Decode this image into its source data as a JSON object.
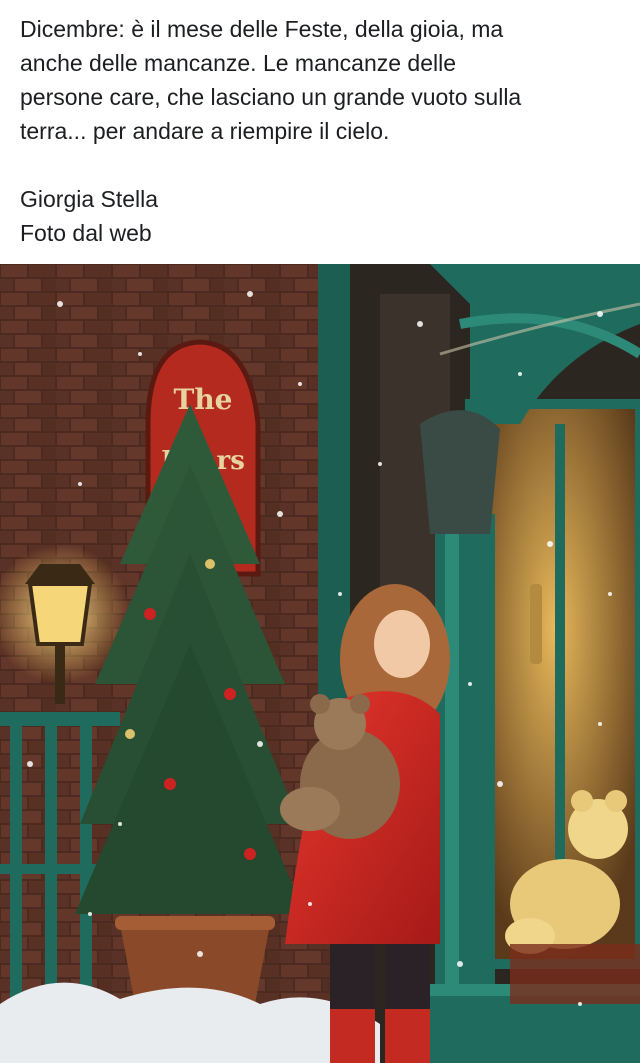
{
  "post": {
    "body_lines": [
      "Dicembre: è il mese delle Feste, della gioia, ma",
      "anche delle mancanze. Le mancanze delle",
      "persone care, che lasciano un grande vuoto sulla",
      "terra... per andare a riempire il cielo."
    ],
    "author": "Giorgia Stella",
    "credit": "Foto dal web"
  },
  "photo": {
    "sign_line_1": "The",
    "sign_line_2": "Bears"
  },
  "colors": {
    "text": "#1c1e21",
    "coat_red": "#d32a24",
    "door_green": "#1f6b5d",
    "brick": "#6b3a2c"
  }
}
